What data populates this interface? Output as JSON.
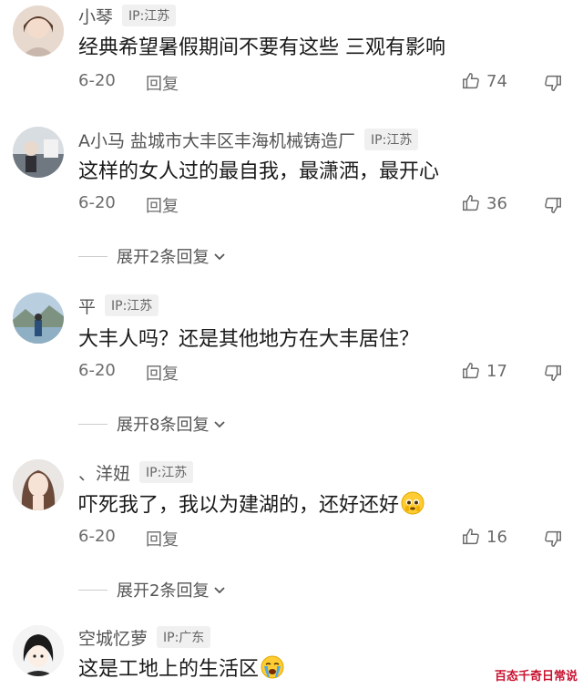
{
  "comments": [
    {
      "username": "小琴",
      "ip": "IP:江苏",
      "text": "经典希望暑假期间不要有这些 三观有影响",
      "date": "6-20",
      "reply_label": "回复",
      "likes": "74"
    },
    {
      "username": "A小马 盐城市大丰区丰海机械铸造厂",
      "ip": "IP:江苏",
      "text": "这样的女人过的最自我，最潇洒，最开心",
      "date": "6-20",
      "reply_label": "回复",
      "likes": "36",
      "expand": "展开2条回复"
    },
    {
      "username": "平",
      "ip": "IP:江苏",
      "text": "大丰人吗？还是其他地方在大丰居住？",
      "date": "6-20",
      "reply_label": "回复",
      "likes": "17",
      "expand": "展开8条回复"
    },
    {
      "username": "、洋妞",
      "ip": "IP:江苏",
      "text": "吓死我了，我以为建湖的，还好还好",
      "date": "6-20",
      "reply_label": "回复",
      "likes": "16",
      "expand": "展开2条回复"
    },
    {
      "username": "空城忆萝",
      "ip": "IP:广东",
      "text": "这是工地上的生活区"
    }
  ],
  "watermark": "百态千奇日常说",
  "icons": {
    "like": "thumbs-up-icon",
    "dislike": "thumbs-down-icon",
    "expand": "chevron-down-icon"
  }
}
